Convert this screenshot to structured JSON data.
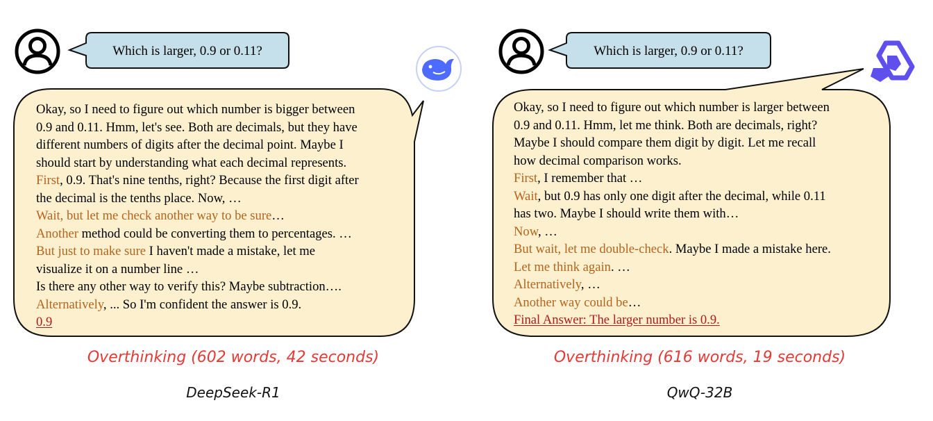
{
  "panels": [
    {
      "question": "Which is larger, 0.9 or 0.11?",
      "answer_lines": [
        [
          {
            "text": "Okay, so I need to figure out which number is bigger between",
            "style": "n"
          }
        ],
        [
          {
            "text": "0.9 and 0.11. Hmm, let's see. Both are decimals, but they have",
            "style": "n"
          }
        ],
        [
          {
            "text": "different numbers of digits after the decimal point. Maybe I",
            "style": "n"
          }
        ],
        [
          {
            "text": "should start by understanding what each decimal represents.",
            "style": "n"
          }
        ],
        [
          {
            "text": "First",
            "style": "h"
          },
          {
            "text": ", 0.9. That's nine tenths, right? Because the first digit after",
            "style": "n"
          }
        ],
        [
          {
            "text": "the decimal is the tenths place. Now, …",
            "style": "n"
          }
        ],
        [
          {
            "text": "Wait, but let me check another way to be sure",
            "style": "h"
          },
          {
            "text": "…",
            "style": "n"
          }
        ],
        [
          {
            "text": "Another",
            "style": "h"
          },
          {
            "text": " method could be converting them to percentages. …",
            "style": "n"
          }
        ],
        [
          {
            "text": "But just to make sure",
            "style": "h"
          },
          {
            "text": " I haven't made a mistake, let me",
            "style": "n"
          }
        ],
        [
          {
            "text": "visualize it on a number line …",
            "style": "n"
          }
        ],
        [
          {
            "text": "Is there any other way to verify this? Maybe subtraction….",
            "style": "n"
          }
        ],
        [
          {
            "text": "Alternatively",
            "style": "h"
          },
          {
            "text": ", ... So I'm confident the answer is 0.9.",
            "style": "n"
          }
        ],
        [
          {
            "text": "0.9",
            "style": "u"
          }
        ]
      ],
      "caption": "Overthinking (602 words, 42 seconds)",
      "model_name": "DeepSeek-R1"
    },
    {
      "question": "Which is larger, 0.9 or 0.11?",
      "answer_lines": [
        [
          {
            "text": "Okay, so I need to figure out which number is larger between",
            "style": "n"
          }
        ],
        [
          {
            "text": "0.9 and 0.11. Hmm, let me think. Both are decimals, right?",
            "style": "n"
          }
        ],
        [
          {
            "text": "Maybe I should compare them digit by digit. Let me recall",
            "style": "n"
          }
        ],
        [
          {
            "text": "how decimal comparison works.",
            "style": "n"
          }
        ],
        [
          {
            "text": "First",
            "style": "h"
          },
          {
            "text": ", I remember that …",
            "style": "n"
          }
        ],
        [
          {
            "text": "Wait",
            "style": "h"
          },
          {
            "text": ", but 0.9 has only one digit after the decimal, while 0.11",
            "style": "n"
          }
        ],
        [
          {
            "text": "has two. Maybe I should write them with…",
            "style": "n"
          }
        ],
        [
          {
            "text": "Now",
            "style": "h"
          },
          {
            "text": ", …",
            "style": "n"
          }
        ],
        [
          {
            "text": "But wait, let me double-check",
            "style": "h"
          },
          {
            "text": ". Maybe I made a mistake here.",
            "style": "n"
          }
        ],
        [
          {
            "text": "Let me think again",
            "style": "h"
          },
          {
            "text": ". …",
            "style": "n"
          }
        ],
        [
          {
            "text": "Alternatively",
            "style": "h"
          },
          {
            "text": ", …",
            "style": "n"
          }
        ],
        [
          {
            "text": "Another way could be",
            "style": "h"
          },
          {
            "text": "…",
            "style": "n"
          }
        ],
        [
          {
            "text": "Final Answer: The larger number is 0.9.",
            "style": "u"
          }
        ]
      ],
      "caption": "Overthinking (616 words, 19 seconds)",
      "model_name": "QwQ-32B"
    }
  ],
  "colors": {
    "question_bubble_fill": "#c5e0ea",
    "answer_bubble_fill": "#fcf0cf",
    "hesitation_text": "#b4641e",
    "final_answer_text": "#b01a1a",
    "caption_text": "#e53935",
    "deepseek_logo": "#4d6bfe",
    "qwen_logo": "#5f50ee"
  },
  "icons": {
    "user": "user-avatar-icon",
    "deepseek": "deepseek-whale-logo",
    "qwen": "qwen-logo"
  }
}
